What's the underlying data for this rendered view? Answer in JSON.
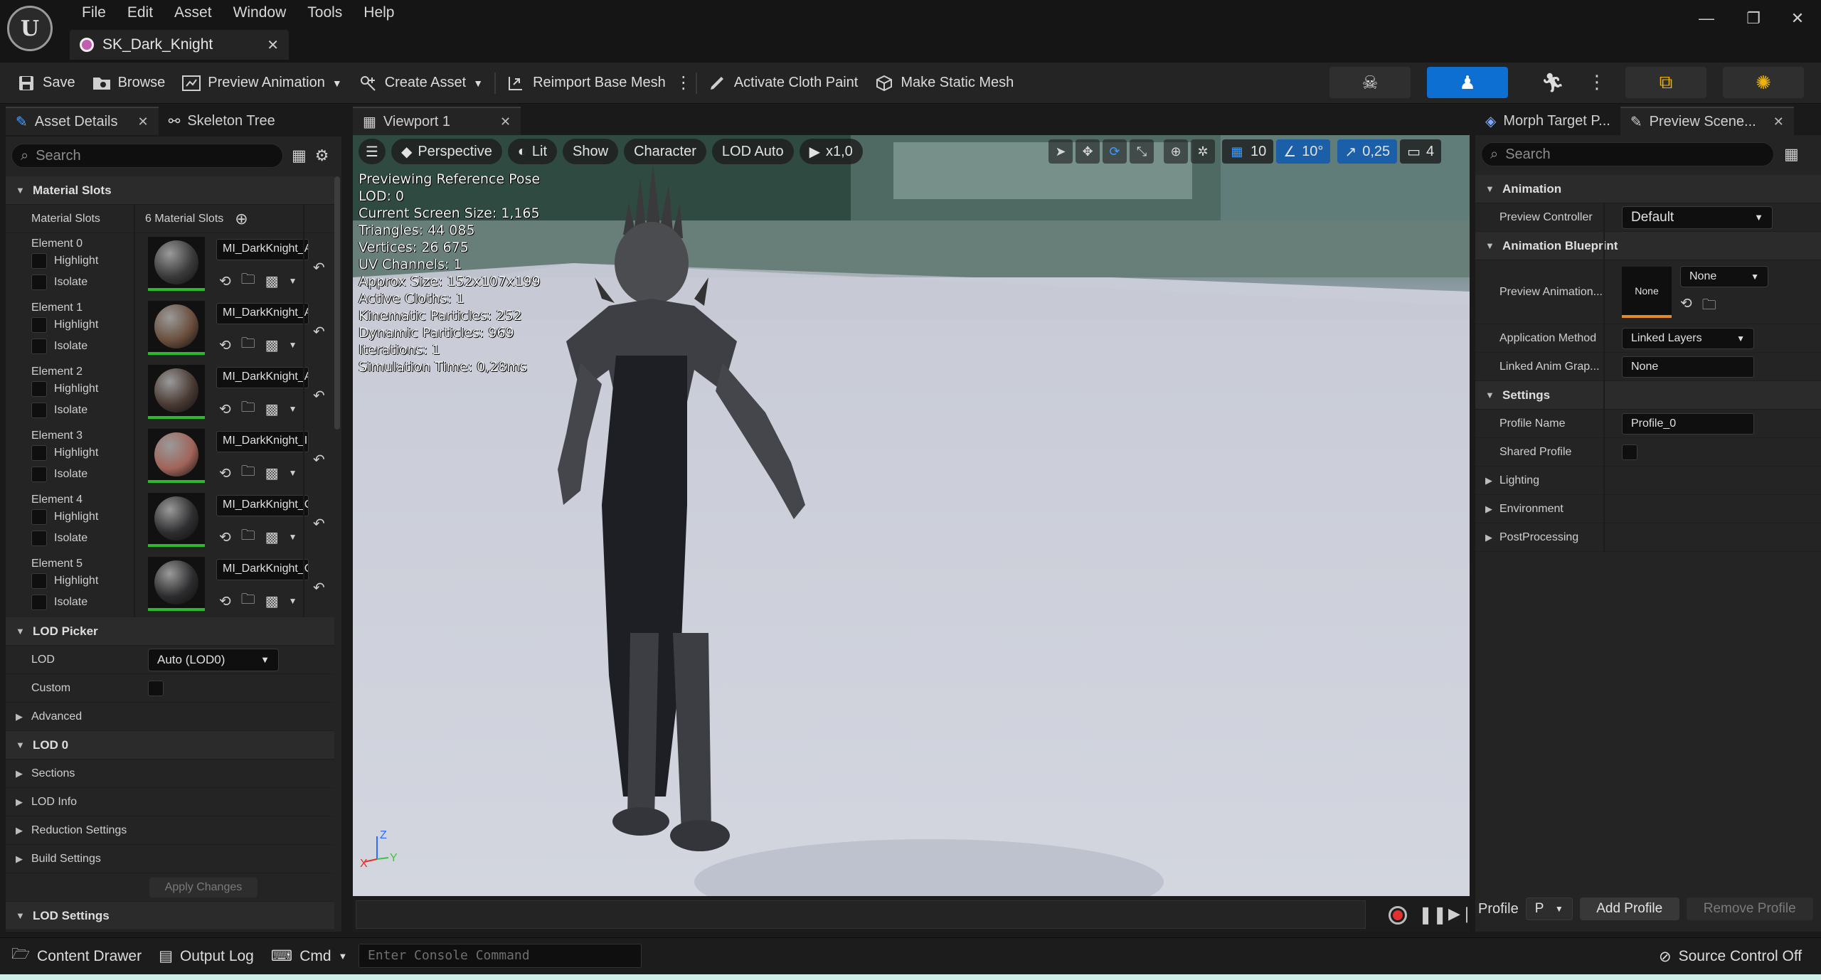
{
  "app": {
    "document_tab": "SK_Dark_Knight",
    "menu": [
      "File",
      "Edit",
      "Asset",
      "Window",
      "Tools",
      "Help"
    ]
  },
  "toolbar": {
    "save": "Save",
    "browse": "Browse",
    "preview_animation": "Preview Animation",
    "create_asset": "Create Asset",
    "reimport_base_mesh": "Reimport Base Mesh",
    "activate_cloth_paint": "Activate Cloth Paint",
    "make_static_mesh": "Make Static Mesh"
  },
  "left_panel": {
    "tabs": [
      "Asset Details",
      "Skeleton Tree"
    ],
    "search_placeholder": "Search",
    "material_slots_header": "Material Slots",
    "material_slots_label": "Material Slots",
    "material_slots_count": "6 Material Slots",
    "highlight_label": "Highlight",
    "isolate_label": "Isolate",
    "elements": [
      {
        "label": "Element 0",
        "material": "MI_DarkKnight_A"
      },
      {
        "label": "Element 1",
        "material": "MI_DarkKnight_A"
      },
      {
        "label": "Element 2",
        "material": "MI_DarkKnight_A"
      },
      {
        "label": "Element 3",
        "material": "MI_DarkKnight_I"
      },
      {
        "label": "Element 4",
        "material": "MI_DarkKnight_C"
      },
      {
        "label": "Element 5",
        "material": "MI_DarkKnight_C"
      }
    ],
    "lod_picker_header": "LOD Picker",
    "lod_label": "LOD",
    "lod_value": "Auto (LOD0)",
    "custom_label": "Custom",
    "advanced_label": "Advanced",
    "lod0_header": "LOD 0",
    "sections_label": "Sections",
    "lod_info_label": "LOD Info",
    "reduction_settings_label": "Reduction Settings",
    "build_settings_label": "Build Settings",
    "apply_changes": "Apply Changes",
    "lod_settings_header": "LOD Settings"
  },
  "viewport": {
    "tab": "Viewport 1",
    "perspective": "Perspective",
    "lit": "Lit",
    "show": "Show",
    "character": "Character",
    "lod_auto": "LOD Auto",
    "play_speed": "x1,0",
    "grid_snap": "10",
    "rotation_snap": "10°",
    "scale_snap": "0,25",
    "camera_speed": "4",
    "stats": [
      "Previewing Reference Pose",
      "LOD: 0",
      "Current Screen Size: 1,165",
      "Triangles: 44 085",
      "Vertices: 26 675",
      "UV Channels: 1",
      "Approx Size: 152x107x199",
      "Active Cloths: 1",
      "Kinematic Particles: 252",
      "Dynamic Particles: 969",
      "Iterations: 1",
      "Simulation Time: 0,28ms"
    ],
    "axis": {
      "z": "Z",
      "x": "X",
      "y": "Y"
    }
  },
  "right_panel": {
    "tabs": [
      "Morph Target P...",
      "Preview Scene..."
    ],
    "search_placeholder": "Search",
    "animation_header": "Animation",
    "preview_controller_label": "Preview Controller",
    "preview_controller_value": "Default",
    "animation_blueprint_header": "Animation Blueprint",
    "preview_animation_label": "Preview Animation...",
    "preview_animation_thumb": "None",
    "preview_animation_value": "None",
    "application_method_label": "Application Method",
    "application_method_value": "Linked Layers",
    "linked_anim_graph_label": "Linked Anim Grap...",
    "linked_anim_graph_value": "None",
    "settings_header": "Settings",
    "profile_name_label": "Profile Name",
    "profile_name_value": "Profile_0",
    "shared_profile_label": "Shared Profile",
    "lighting_label": "Lighting",
    "environment_label": "Environment",
    "postprocessing_label": "PostProcessing",
    "profile_label": "Profile",
    "profile_combo": "P",
    "add_profile": "Add Profile",
    "remove_profile": "Remove Profile"
  },
  "statusbar": {
    "content_drawer": "Content Drawer",
    "output_log": "Output Log",
    "cmd": "Cmd",
    "console_placeholder": "Enter Console Command",
    "source_control": "Source Control Off"
  },
  "colors": {
    "accent_blue": "#0d6fd1",
    "material_green": "#2eb82e",
    "record_red": "#e03030"
  }
}
